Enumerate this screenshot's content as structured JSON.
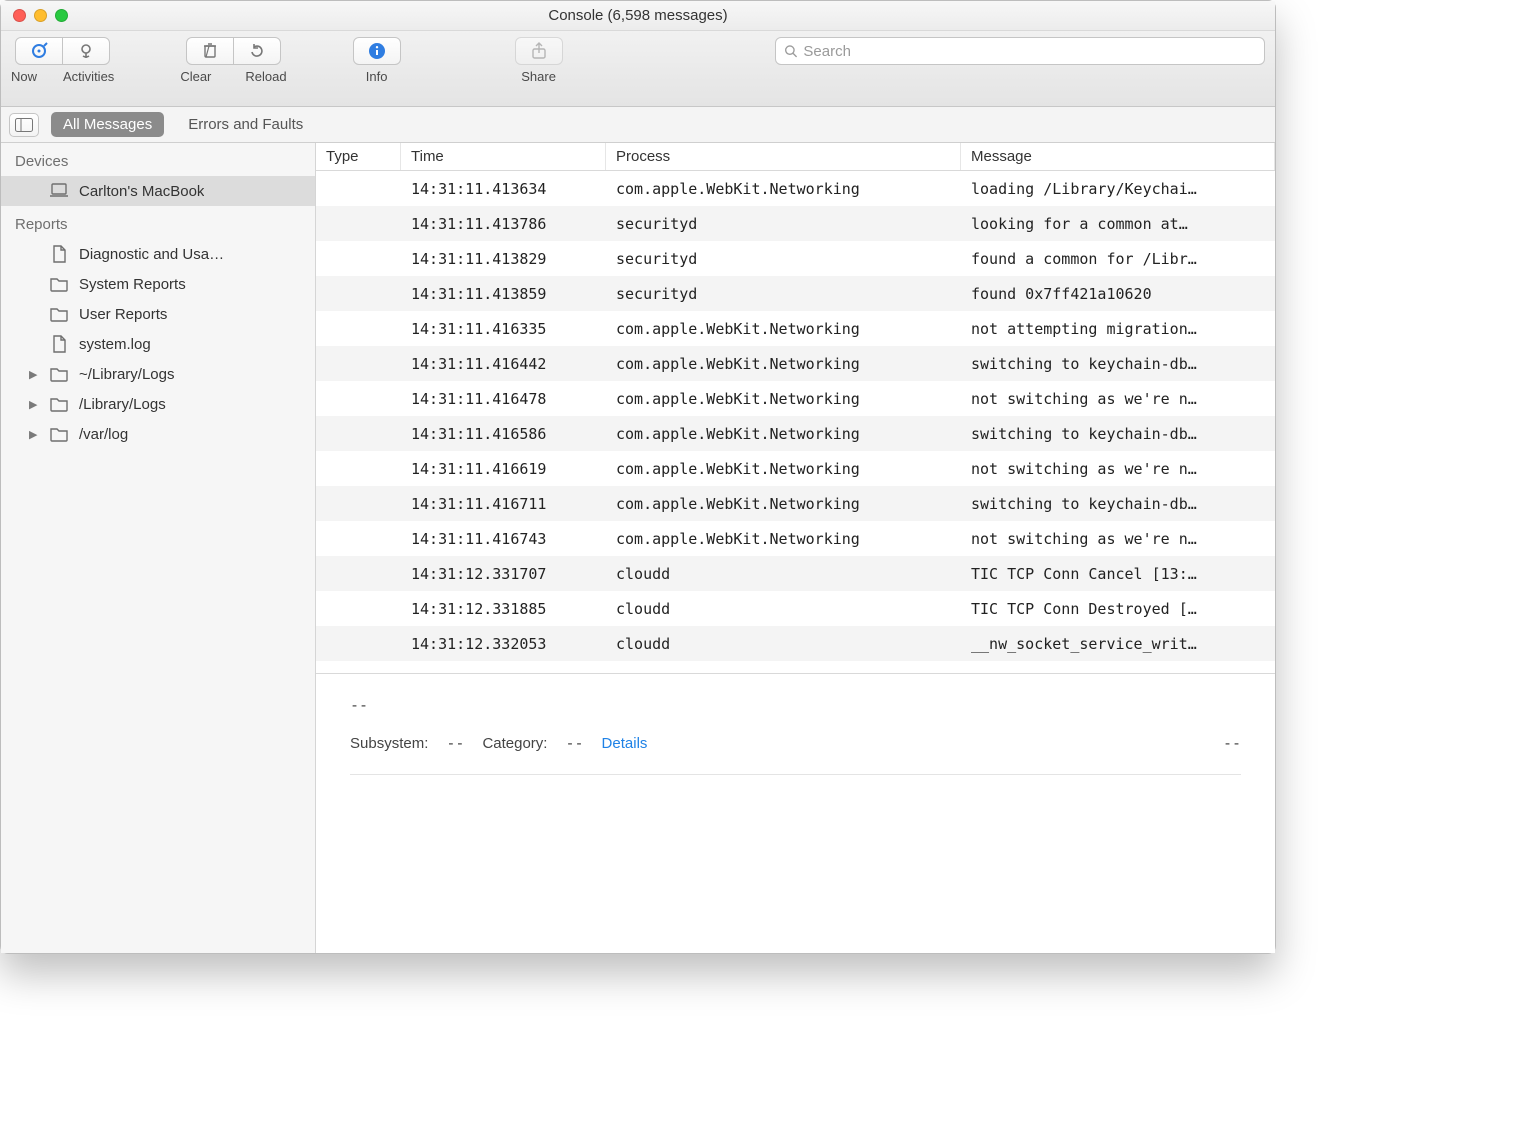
{
  "window": {
    "title": "Console (6,598 messages)"
  },
  "toolbar": {
    "now": "Now",
    "activities": "Activities",
    "clear": "Clear",
    "reload": "Reload",
    "info": "Info",
    "share": "Share",
    "search_placeholder": "Search"
  },
  "filter": {
    "all_messages": "All Messages",
    "errors_faults": "Errors and Faults"
  },
  "sidebar": {
    "devices_header": "Devices",
    "device": "Carlton's MacBook",
    "reports_header": "Reports",
    "items": [
      {
        "label": "Diagnostic and Usa…",
        "icon": "doc"
      },
      {
        "label": "System Reports",
        "icon": "folder"
      },
      {
        "label": "User Reports",
        "icon": "folder"
      },
      {
        "label": "system.log",
        "icon": "doc"
      },
      {
        "label": "~/Library/Logs",
        "icon": "folder",
        "arrow": true
      },
      {
        "label": "/Library/Logs",
        "icon": "folder",
        "arrow": true
      },
      {
        "label": "/var/log",
        "icon": "folder",
        "arrow": true
      }
    ]
  },
  "columns": {
    "type": "Type",
    "time": "Time",
    "process": "Process",
    "message": "Message"
  },
  "rows": [
    {
      "time": "14:31:11.413634",
      "process": "com.apple.WebKit.Networking",
      "message": "loading /Library/Keychai…"
    },
    {
      "time": "14:31:11.413786",
      "process": "securityd",
      "message": "looking for a common at…"
    },
    {
      "time": "14:31:11.413829",
      "process": "securityd",
      "message": "found a common for /Libr…"
    },
    {
      "time": "14:31:11.413859",
      "process": "securityd",
      "message": "found 0x7ff421a10620"
    },
    {
      "time": "14:31:11.416335",
      "process": "com.apple.WebKit.Networking",
      "message": "not attempting migration…"
    },
    {
      "time": "14:31:11.416442",
      "process": "com.apple.WebKit.Networking",
      "message": "switching to keychain-db…"
    },
    {
      "time": "14:31:11.416478",
      "process": "com.apple.WebKit.Networking",
      "message": "not switching as we're n…"
    },
    {
      "time": "14:31:11.416586",
      "process": "com.apple.WebKit.Networking",
      "message": "switching to keychain-db…"
    },
    {
      "time": "14:31:11.416619",
      "process": "com.apple.WebKit.Networking",
      "message": "not switching as we're n…"
    },
    {
      "time": "14:31:11.416711",
      "process": "com.apple.WebKit.Networking",
      "message": "switching to keychain-db…"
    },
    {
      "time": "14:31:11.416743",
      "process": "com.apple.WebKit.Networking",
      "message": "not switching as we're n…"
    },
    {
      "time": "14:31:12.331707",
      "process": "cloudd",
      "message": "TIC TCP Conn Cancel [13:…"
    },
    {
      "time": "14:31:12.331885",
      "process": "cloudd",
      "message": "TIC TCP Conn Destroyed […"
    },
    {
      "time": "14:31:12.332053",
      "process": "cloudd",
      "message": "__nw_socket_service_writ…"
    }
  ],
  "detail": {
    "dash": "--",
    "subsystem_label": "Subsystem:",
    "subsystem_value": "--",
    "category_label": "Category:",
    "category_value": "--",
    "details_link": "Details",
    "right": "--"
  }
}
